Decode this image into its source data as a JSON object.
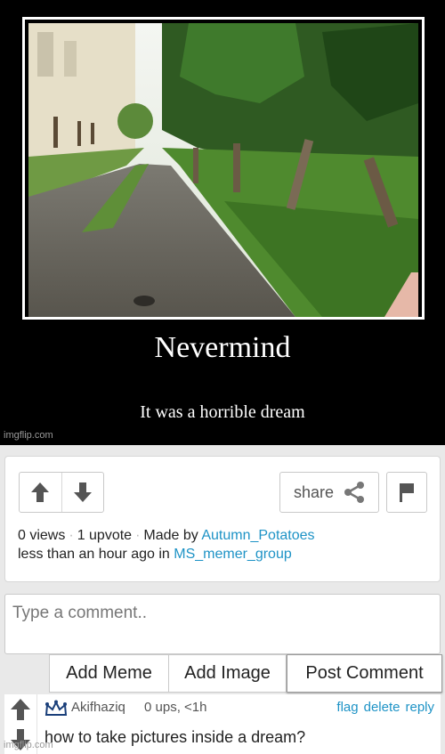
{
  "meme": {
    "title": "Nevermind",
    "caption": "It was a horrible dream",
    "watermark": "imgflip.com"
  },
  "actions": {
    "share_label": "share"
  },
  "stats": {
    "views": "0 views",
    "upvotes": "1 upvote",
    "made_by_prefix": "Made by",
    "author": "Autumn_Potatoes",
    "posted_prefix": "less than an hour ago in",
    "group": "MS_memer_group"
  },
  "comment_input": {
    "placeholder": "Type a comment.."
  },
  "buttons": {
    "add_meme": "Add Meme",
    "add_image": "Add Image",
    "post_comment": "Post Comment"
  },
  "comment": {
    "username": "Akifhaziq",
    "meta": "0 ups, <1h",
    "flag": "flag",
    "delete": "delete",
    "reply": "reply",
    "text": "how to take pictures inside a dream?"
  },
  "footer_watermark": "imgflip.com",
  "colors": {
    "link": "#1e93c6",
    "meme_bg": "#000000",
    "icon_gray": "#555555"
  },
  "icons": [
    "arrow-up-icon",
    "arrow-down-icon",
    "share-icon",
    "flag-icon",
    "crown-icon"
  ]
}
